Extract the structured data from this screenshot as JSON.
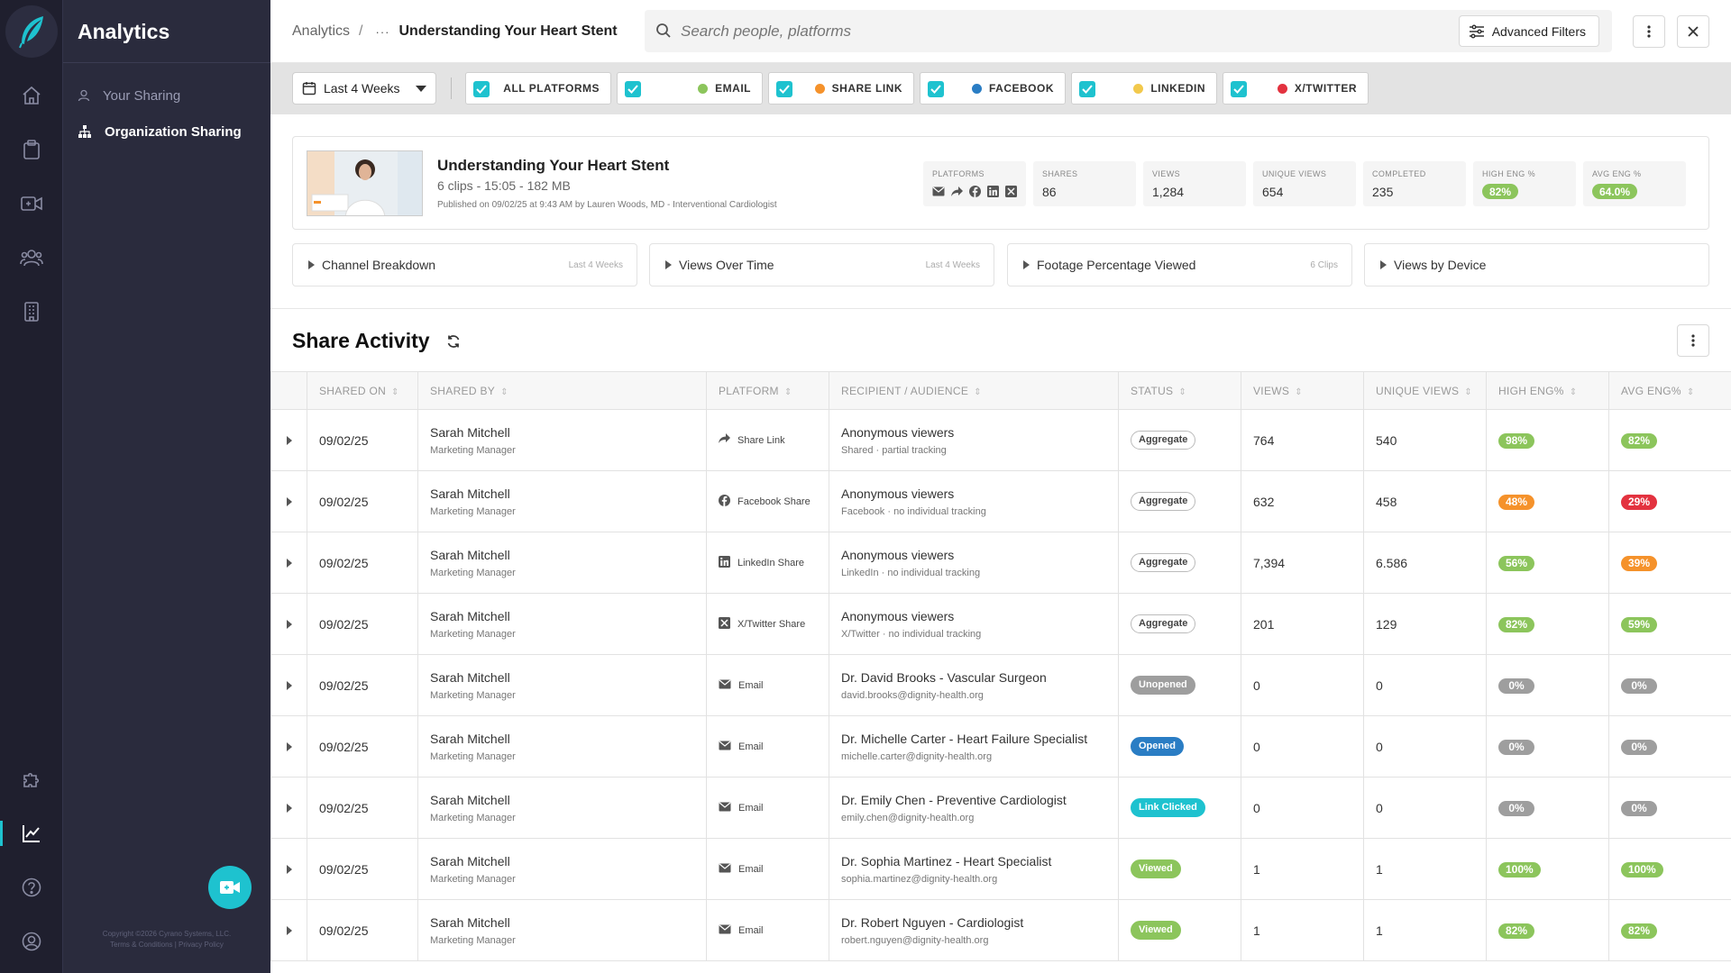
{
  "colors": {
    "accent": "#1ec2cf",
    "rail": "#1f1f2e",
    "panel": "#2a2b3d",
    "green": "#8cc55c",
    "orange": "#f5922b",
    "red": "#e3323f",
    "gray": "#9e9e9e",
    "blue": "#2a7dc4",
    "email_dot": "#8cc55c",
    "sharelink_dot": "#f5922b",
    "facebook_dot": "#2a7dc4",
    "linkedin_dot": "#f2c94c",
    "twitter_dot": "#e3323f"
  },
  "rail": {
    "icons": [
      "home-icon",
      "clipboard-icon",
      "video-camera-icon",
      "people-icon",
      "building-icon",
      "puzzle-icon",
      "analytics-chart-icon",
      "help-icon",
      "user-circle-icon"
    ],
    "active": "analytics-chart-icon"
  },
  "panel": {
    "title": "Analytics",
    "nav": [
      {
        "label": "Your Sharing",
        "icon": "user-icon",
        "active": false
      },
      {
        "label": "Organization Sharing",
        "icon": "org-chart-icon",
        "active": true
      }
    ],
    "copyright": "Copyright ©2026 Cyrano Systems, LLC.",
    "legal": "Terms & Conditions | Privacy Policy"
  },
  "header": {
    "breadcrumb_root": "Analytics",
    "breadcrumb_sep": "/",
    "breadcrumb_more": "···",
    "breadcrumb_current": "Understanding Your Heart Stent",
    "search_placeholder": "Search people, platforms",
    "advanced_filters": "Advanced Filters"
  },
  "filters": {
    "range": "Last 4 Weeks",
    "platforms": [
      {
        "label": "ALL PLATFORMS",
        "checked": true
      },
      {
        "label": "EMAIL",
        "checked": true
      },
      {
        "label": "SHARE LINK",
        "checked": true
      },
      {
        "label": "FACEBOOK",
        "checked": true
      },
      {
        "label": "LINKEDIN",
        "checked": true
      },
      {
        "label": "X/TWITTER",
        "checked": true
      }
    ]
  },
  "video": {
    "title": "Understanding Your Heart Stent",
    "meta": "6 clips - 15:05 - 182 MB",
    "published": "Published on 09/02/25 at 9:43 AM by Lauren Woods,  MD -  Interventional Cardiologist"
  },
  "stats": {
    "platforms_label": "PLATFORMS",
    "shares_label": "SHARES",
    "shares": "86",
    "views_label": "VIEWS",
    "views": "1,284",
    "unique_label": "UNIQUE VIEWS",
    "unique": "654",
    "completed_label": "COMPLETED",
    "completed": "235",
    "high_label": "HIGH ENG %",
    "high": "82%",
    "avg_label": "AVG ENG %",
    "avg": "64.0%"
  },
  "panels": [
    {
      "title": "Channel Breakdown",
      "right": "Last 4 Weeks"
    },
    {
      "title": "Views Over Time",
      "right": "Last 4 Weeks"
    },
    {
      "title": "Footage Percentage Viewed",
      "right": "6 Clips"
    },
    {
      "title": "Views by Device",
      "right": ""
    }
  ],
  "activity": {
    "title": "Share Activity",
    "columns": [
      "SHARED ON",
      "SHARED BY",
      "PLATFORM",
      "RECIPIENT / AUDIENCE",
      "STATUS",
      "VIEWS",
      "UNIQUE VIEWS",
      "HIGH ENG%",
      "AVG ENG%"
    ],
    "rows": [
      {
        "date": "09/02/25",
        "by": "Sarah Mitchell",
        "role": "Marketing Manager",
        "platform": "Share Link",
        "picon": "share-arrow-icon",
        "recipient": "Anonymous viewers",
        "rsub": "Shared · partial tracking",
        "status": "Aggregate",
        "scls": "agg",
        "views": "764",
        "unique": "540",
        "high": "98%",
        "hc": "g",
        "avg": "82%",
        "ac": "g"
      },
      {
        "date": "09/02/25",
        "by": "Sarah Mitchell",
        "role": "Marketing Manager",
        "platform": "Facebook Share",
        "picon": "facebook-icon",
        "recipient": "Anonymous viewers",
        "rsub": "Facebook · no individual tracking",
        "status": "Aggregate",
        "scls": "agg",
        "views": "632",
        "unique": "458",
        "high": "48%",
        "hc": "o",
        "avg": "29%",
        "ac": "r"
      },
      {
        "date": "09/02/25",
        "by": "Sarah Mitchell",
        "role": "Marketing Manager",
        "platform": "LinkedIn Share",
        "picon": "linkedin-icon",
        "recipient": "Anonymous viewers",
        "rsub": "LinkedIn · no individual tracking",
        "status": "Aggregate",
        "scls": "agg",
        "views": "7,394",
        "unique": "6.586",
        "high": "56%",
        "hc": "g",
        "avg": "39%",
        "ac": "o"
      },
      {
        "date": "09/02/25",
        "by": "Sarah Mitchell",
        "role": "Marketing Manager",
        "platform": "X/Twitter Share",
        "picon": "x-twitter-icon",
        "recipient": "Anonymous viewers",
        "rsub": "X/Twitter · no individual tracking",
        "status": "Aggregate",
        "scls": "agg",
        "views": "201",
        "unique": "129",
        "high": "82%",
        "hc": "g",
        "avg": "59%",
        "ac": "g"
      },
      {
        "date": "09/02/25",
        "by": "Sarah Mitchell",
        "role": "Marketing Manager",
        "platform": "Email",
        "picon": "envelope-icon",
        "recipient": "Dr. David Brooks - Vascular Surgeon",
        "rsub": "david.brooks@dignity-health.org",
        "status": "Unopened",
        "scls": "un",
        "views": "0",
        "unique": "0",
        "high": "0%",
        "hc": "n",
        "avg": "0%",
        "ac": "n"
      },
      {
        "date": "09/02/25",
        "by": "Sarah Mitchell",
        "role": "Marketing Manager",
        "platform": "Email",
        "picon": "envelope-icon",
        "recipient": "Dr. Michelle Carter - Heart Failure Specialist",
        "rsub": "michelle.carter@dignity-health.org",
        "status": "Opened",
        "scls": "op",
        "views": "0",
        "unique": "0",
        "high": "0%",
        "hc": "n",
        "avg": "0%",
        "ac": "n"
      },
      {
        "date": "09/02/25",
        "by": "Sarah Mitchell",
        "role": "Marketing Manager",
        "platform": "Email",
        "picon": "envelope-icon",
        "recipient": "Dr. Emily Chen - Preventive Cardiologist",
        "rsub": "emily.chen@dignity-health.org",
        "status": "Link Clicked",
        "scls": "lc",
        "views": "0",
        "unique": "0",
        "high": "0%",
        "hc": "n",
        "avg": "0%",
        "ac": "n"
      },
      {
        "date": "09/02/25",
        "by": "Sarah Mitchell",
        "role": "Marketing Manager",
        "platform": "Email",
        "picon": "envelope-icon",
        "recipient": "Dr. Sophia Martinez - Heart Specialist",
        "rsub": "sophia.martinez@dignity-health.org",
        "status": "Viewed",
        "scls": "vw",
        "views": "1",
        "unique": "1",
        "high": "100%",
        "hc": "g",
        "avg": "100%",
        "ac": "g"
      },
      {
        "date": "09/02/25",
        "by": "Sarah Mitchell",
        "role": "Marketing Manager",
        "platform": "Email",
        "picon": "envelope-icon",
        "recipient": "Dr. Robert Nguyen - Cardiologist",
        "rsub": "robert.nguyen@dignity-health.org",
        "status": "Viewed",
        "scls": "vw",
        "views": "1",
        "unique": "1",
        "high": "82%",
        "hc": "g",
        "avg": "82%",
        "ac": "g"
      }
    ]
  }
}
